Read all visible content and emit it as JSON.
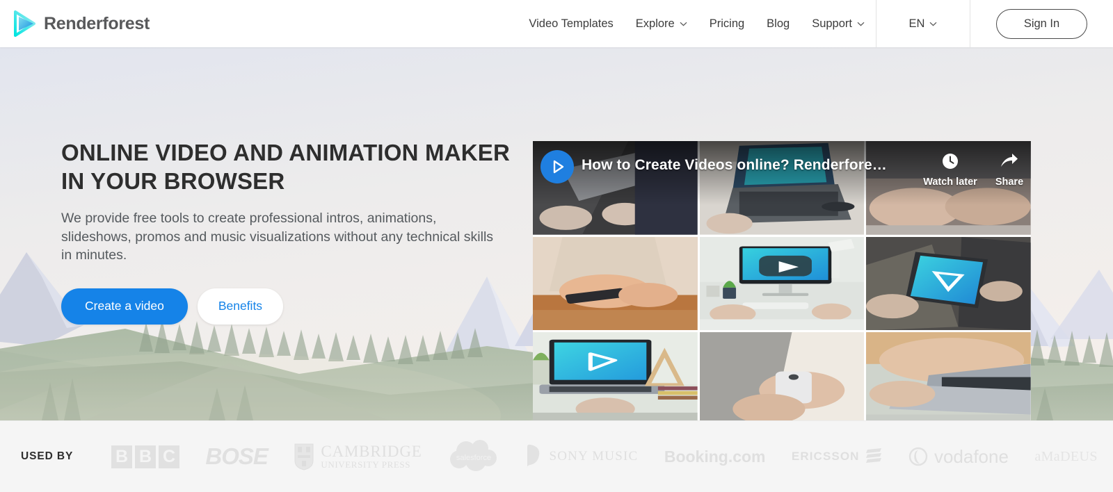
{
  "brand": {
    "name": "Renderforest",
    "logo_icon": "play-triangle-logo",
    "accent": "#00d4e0"
  },
  "nav": {
    "items": [
      {
        "label": "Video Templates",
        "caret": false
      },
      {
        "label": "Explore",
        "caret": true
      },
      {
        "label": "Pricing",
        "caret": false
      },
      {
        "label": "Blog",
        "caret": false
      },
      {
        "label": "Support",
        "caret": true
      }
    ],
    "language": {
      "label": "EN",
      "caret": true
    },
    "sign_in": "Sign In"
  },
  "hero": {
    "headline": "ONLINE VIDEO AND ANIMATION MAKER IN YOUR BROWSER",
    "subcopy": "We provide free tools to create professional intros, animations, slideshows, promos and music visualizations without any technical skills in minutes.",
    "primary_cta": "Create a video",
    "secondary_cta": "Benefits",
    "primary_color": "#1583e8",
    "secondary_color": "#ffffff"
  },
  "video": {
    "title": "How to Create Videos online? Renderfore…",
    "play_icon": "play-circle-icon",
    "watch_later": {
      "label": "Watch later",
      "icon": "clock-icon"
    },
    "share": {
      "label": "Share",
      "icon": "share-arrow-icon"
    }
  },
  "used_by": {
    "label": "USED BY",
    "brands": [
      {
        "name": "BBC"
      },
      {
        "name": "BOSE"
      },
      {
        "name": "CAMBRIDGE",
        "sub": "UNIVERSITY PRESS"
      },
      {
        "name": "salesforce"
      },
      {
        "name": "SONY MUSIC"
      },
      {
        "name": "Booking.com"
      },
      {
        "name": "ERICSSON"
      },
      {
        "name": "vodafone"
      },
      {
        "name": "aMaDEUS"
      }
    ]
  }
}
